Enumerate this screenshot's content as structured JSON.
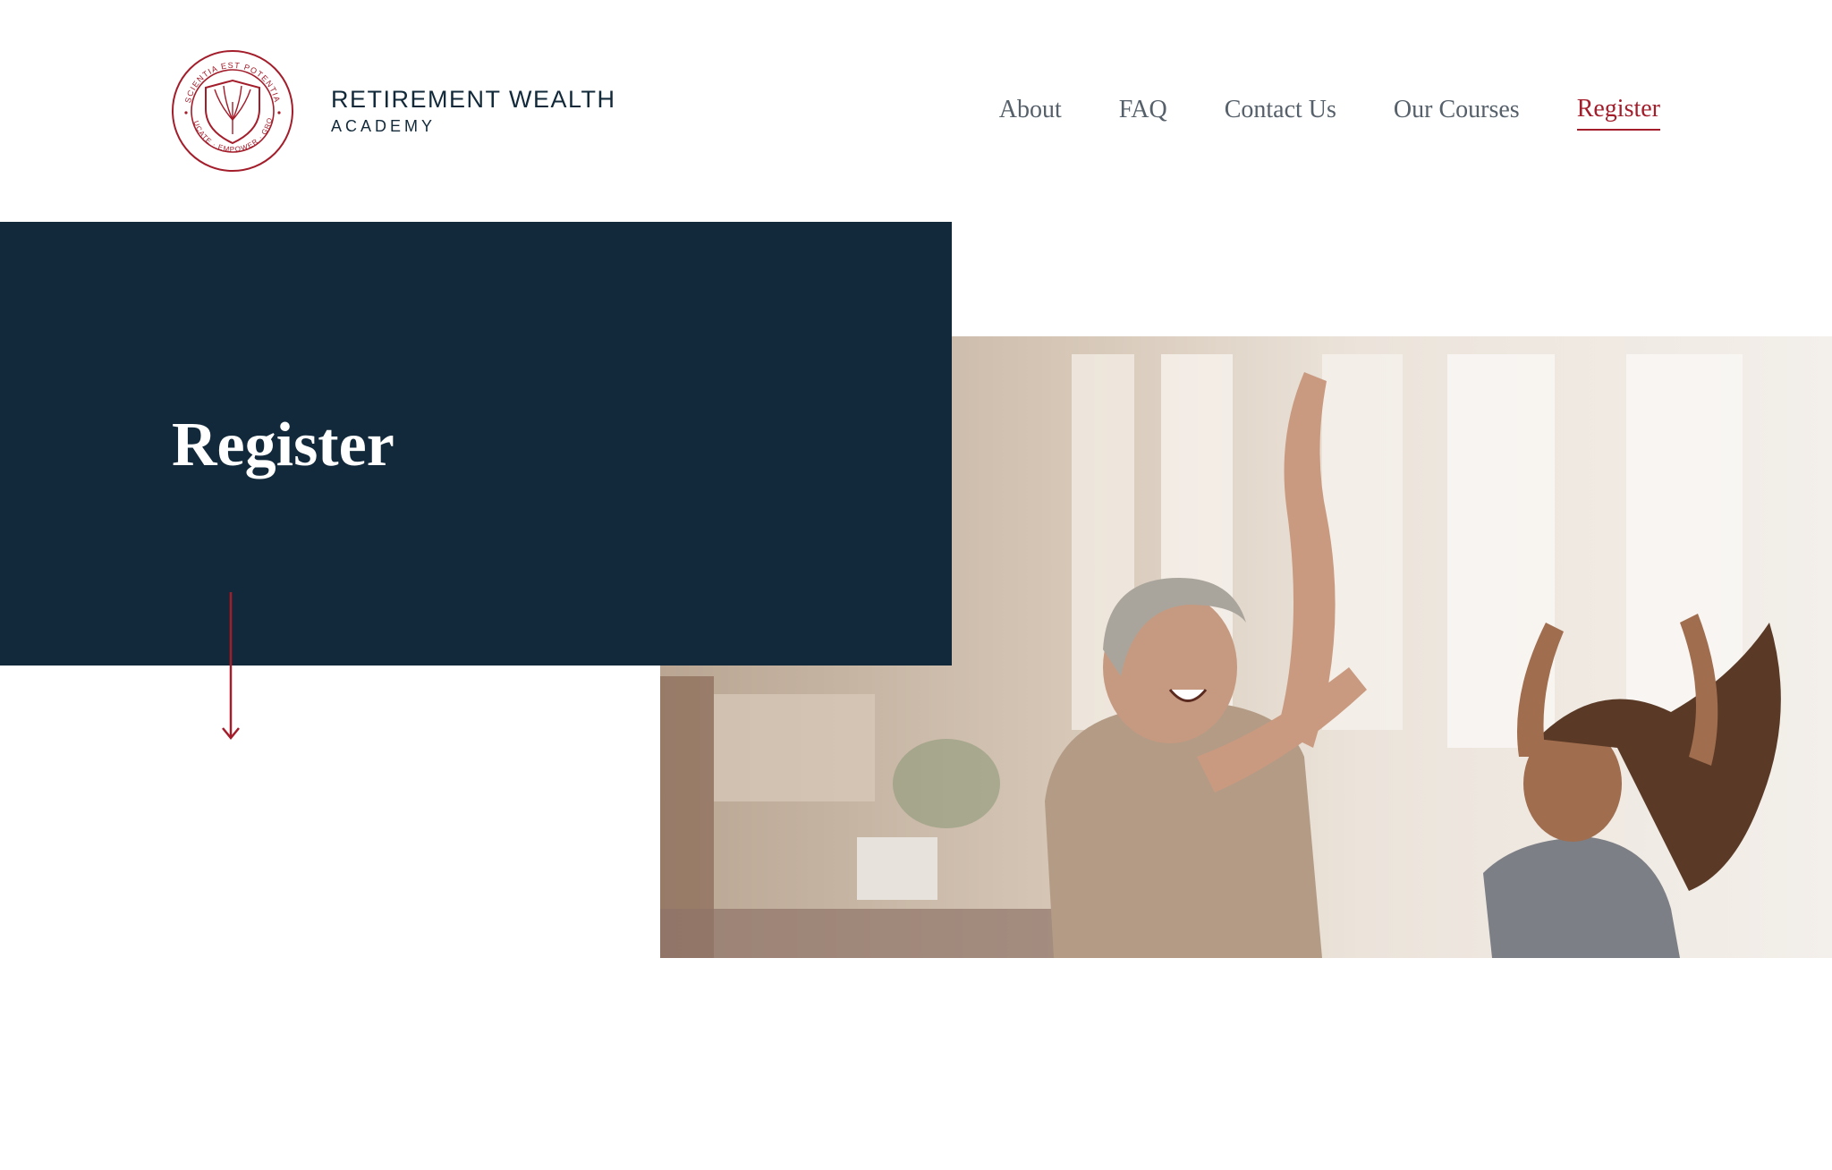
{
  "brand": {
    "name_line1": "RETIREMENT WEALTH",
    "name_line2": "ACADEMY",
    "seal_top_text": "SCIENTIA EST POTENTIA",
    "seal_bottom_text": "EDUCATE · EMPOWER · GROW"
  },
  "nav": {
    "items": [
      "About",
      "FAQ",
      "Contact Us",
      "Our Courses",
      "Register"
    ],
    "active": "Register"
  },
  "hero": {
    "title": "Register",
    "image": "photo of an older woman and a young girl laughing and dancing in a living room"
  },
  "colors": {
    "navy": "#11293a",
    "accent_red": "#a31d2b",
    "nav_text": "#56606a"
  },
  "icons": {
    "scroll": "arrow-down-icon",
    "logo": "shield-seal-icon"
  }
}
